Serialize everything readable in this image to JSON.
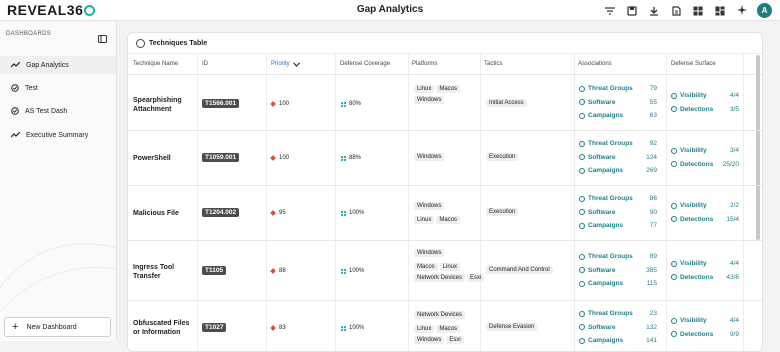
{
  "app": {
    "brand": "REVEAL36",
    "page_title": "Gap Analytics",
    "avatar_initial": "A"
  },
  "sidebar": {
    "header": "DASHBOARDS",
    "items": [
      {
        "label": "Gap Analytics",
        "icon": "trend-icon",
        "active": true
      },
      {
        "label": "Test",
        "icon": "check-circle-icon",
        "active": false
      },
      {
        "label": "AS Test Dash",
        "icon": "check-circle-icon",
        "active": false
      },
      {
        "label": "Executive Summary",
        "icon": "trend-icon",
        "active": false
      }
    ],
    "new_dashboard": "New Dashboard"
  },
  "table": {
    "title": "Techniques Table",
    "headers": {
      "name": "Technique Name",
      "id": "ID",
      "priority": "Priority",
      "coverage": "Defense Coverage",
      "platforms": "Platforms",
      "tactics": "Tactics",
      "associations": "Associations",
      "surface": "Defense Surface"
    },
    "labels": {
      "threat_groups": "Threat Groups",
      "software": "Software",
      "campaigns": "Campaigns",
      "visibility": "Visibility",
      "detections": "Detections"
    },
    "rows": [
      {
        "name": "Spearphishing Attachment",
        "id": "T1566.001",
        "priority": "100",
        "coverage": "80%",
        "platforms": [
          "Linux",
          "Macos",
          "Windows"
        ],
        "tactic": "Initial Access",
        "threat_groups": "79",
        "software": "55",
        "campaigns": "63",
        "visibility": "4/4",
        "detections": "3/5"
      },
      {
        "name": "PowerShell",
        "id": "T1059.001",
        "priority": "100",
        "coverage": "88%",
        "platforms": [
          "Windows"
        ],
        "tactic": "Execution",
        "threat_groups": "92",
        "software": "124",
        "campaigns": "269",
        "visibility": "3/4",
        "detections": "25/20"
      },
      {
        "name": "Malicious File",
        "id": "T1204.002",
        "priority": "95",
        "coverage": "100%",
        "platforms": [
          "Windows",
          "Linux",
          "Macos"
        ],
        "tactic": "Execution",
        "threat_groups": "86",
        "software": "90",
        "campaigns": "77",
        "visibility": "2/2",
        "detections": "15/4"
      },
      {
        "name": "Ingress Tool Transfer",
        "id": "T1105",
        "priority": "88",
        "coverage": "100%",
        "platforms": [
          "Windows",
          "Macos",
          "Linux",
          "Network Devices",
          "Esxi"
        ],
        "tactic": "Command And Control",
        "threat_groups": "89",
        "software": "385",
        "campaigns": "115",
        "visibility": "4/4",
        "detections": "43/6"
      },
      {
        "name": "Obfuscated Files or Information",
        "id": "T1027",
        "priority": "83",
        "coverage": "100%",
        "platforms": [
          "Network Devices",
          "Linux",
          "Macos",
          "Windows",
          "Esxi"
        ],
        "tactic": "Defense Evasion",
        "threat_groups": "23",
        "software": "132",
        "campaigns": "141",
        "visibility": "4/4",
        "detections": "9/9"
      }
    ]
  },
  "colors": {
    "accent": "#1f7f88",
    "brand_ring": "#1fb5a6",
    "priority_diamond": "#e24b3b",
    "id_badge": "#4d4d4d"
  }
}
